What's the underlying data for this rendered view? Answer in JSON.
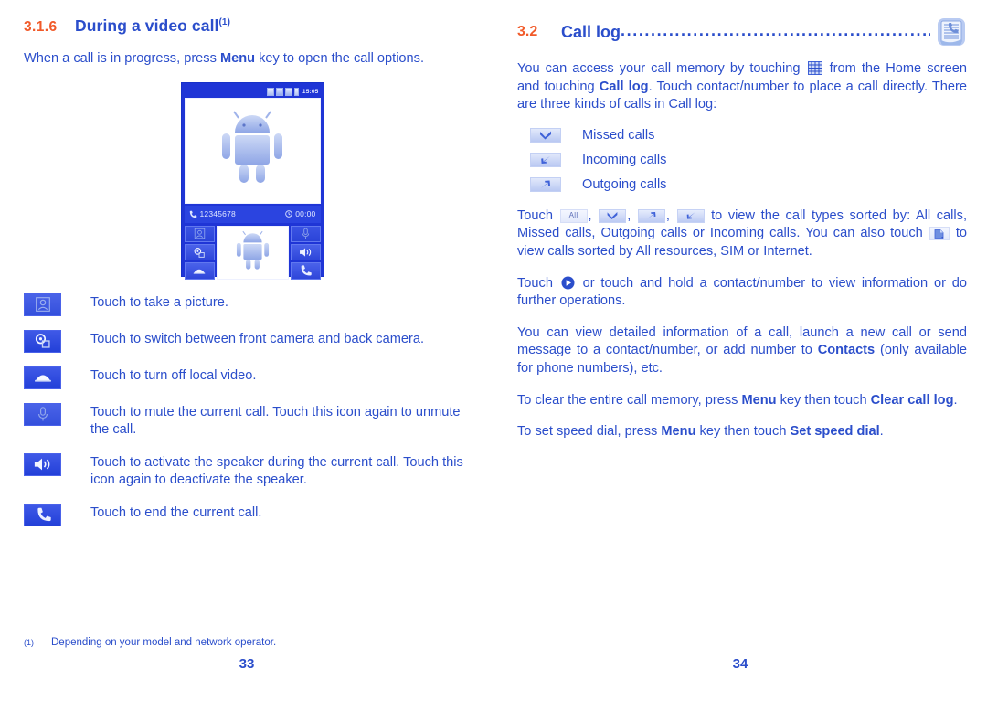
{
  "left": {
    "heading": {
      "number": "3.1.6",
      "title": "During a video call",
      "footnote_mark": "(1)"
    },
    "intro_pre": "When a call is in progress, press ",
    "intro_bold": "Menu",
    "intro_post": " key to open the call options.",
    "phone": {
      "status_time": "15:05",
      "caller_number": "12345678",
      "call_timer": "00:00"
    },
    "icon_rows": [
      {
        "icon": "take-picture-icon",
        "text": "Touch to take a picture."
      },
      {
        "icon": "switch-camera-icon",
        "text": "Touch to switch between front camera and back camera."
      },
      {
        "icon": "turn-off-video-icon",
        "text": "Touch to turn off local video."
      },
      {
        "icon": "mute-icon",
        "text": "Touch to mute the current call. Touch this icon again to unmute the call."
      },
      {
        "icon": "speaker-icon",
        "text": "Touch to activate the speaker during the current call. Touch this icon again to deactivate the speaker."
      },
      {
        "icon": "end-call-icon",
        "text": "Touch to end the current call."
      }
    ],
    "footnote": {
      "mark": "(1)",
      "text": "Depending on your model and network operator."
    },
    "page_number": "33"
  },
  "right": {
    "heading": {
      "number": "3.2",
      "title": "Call log",
      "leader": "................................................................"
    },
    "p1": {
      "a": "You can access your call memory by touching ",
      "icon": "app-grid-icon",
      "b": " from the Home screen and touching ",
      "bold": "Call log",
      "c": ". Touch contact/number to place a call directly. There are three kinds of calls in Call log:"
    },
    "call_types": [
      {
        "icon": "missed-call-icon",
        "label": "Missed calls"
      },
      {
        "icon": "incoming-call-icon",
        "label": "Incoming calls"
      },
      {
        "icon": "outgoing-call-icon",
        "label": "Outgoing calls"
      }
    ],
    "p2": {
      "a": "Touch ",
      "icon_all_label": "All",
      "sep": ", ",
      "b": " to view the call types sorted by: All calls, Missed calls, Outgoing calls or Incoming calls. You can also touch ",
      "icon_resources": "resources-filter-icon",
      "c": " to view calls sorted by All resources, SIM or Internet."
    },
    "p3": {
      "a": "Touch ",
      "icon": "view-details-icon",
      "b": " or touch and hold a contact/number to view information or do further operations."
    },
    "p4": {
      "a": "You can view detailed information of a call, launch a new call or send message to a contact/number, or add number to ",
      "bold": "Contacts",
      "b": " (only available for phone numbers), etc."
    },
    "p5": {
      "a": "To clear the entire call memory, press ",
      "bold1": "Menu",
      "b": " key then touch ",
      "bold2": "Clear call log",
      "c": "."
    },
    "p6": {
      "a": "To set speed dial, press ",
      "bold1": "Menu",
      "b": " key then touch ",
      "bold2": "Set speed dial",
      "c": "."
    },
    "page_number": "34"
  },
  "colors": {
    "accent_orange": "#f15a29",
    "text_blue": "#2b4ecb",
    "phone_blue": "#1f35d6"
  }
}
